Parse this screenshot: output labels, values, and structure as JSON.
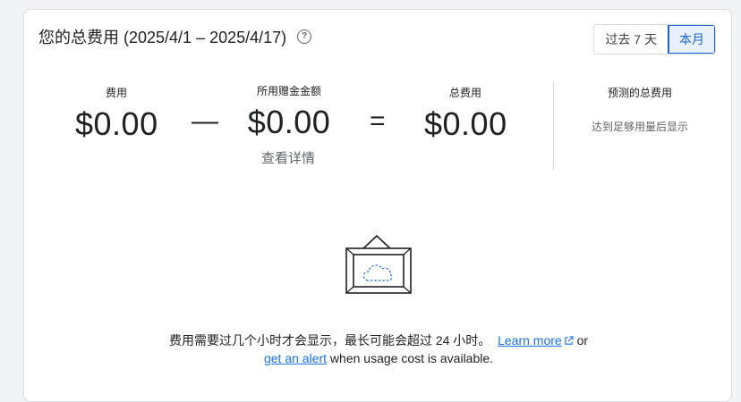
{
  "header": {
    "title": "您的总费用 (2025/4/1 – 2025/4/17)",
    "help_icon": "help-circle-icon"
  },
  "range_toggle": {
    "options": [
      "过去 7 天",
      "本月"
    ],
    "selected": "本月"
  },
  "summary": {
    "cost": {
      "label": "费用",
      "value": "$0.00"
    },
    "minus": "—",
    "credits": {
      "label": "所用赠金金额",
      "value": "$0.00",
      "details_link": "查看详情"
    },
    "equals": "=",
    "total": {
      "label": "总费用",
      "value": "$0.00"
    }
  },
  "projection": {
    "label": "预测的总费用",
    "note": "达到足够用量后显示"
  },
  "empty_state": {
    "illustration_icon": "framed-cloud-icon",
    "line1_text": "费用需要过几个小时才会显示，最长可能会超过 24 小时。",
    "learn_more": "Learn more",
    "external_icon": "open-in-new-icon",
    "or_text": "or",
    "get_alert": "get an alert",
    "line2_text": "when usage cost is available."
  },
  "colors": {
    "accent": "#1a73e8",
    "selected_bg": "#e8f0fe",
    "border": "#dadce0"
  }
}
